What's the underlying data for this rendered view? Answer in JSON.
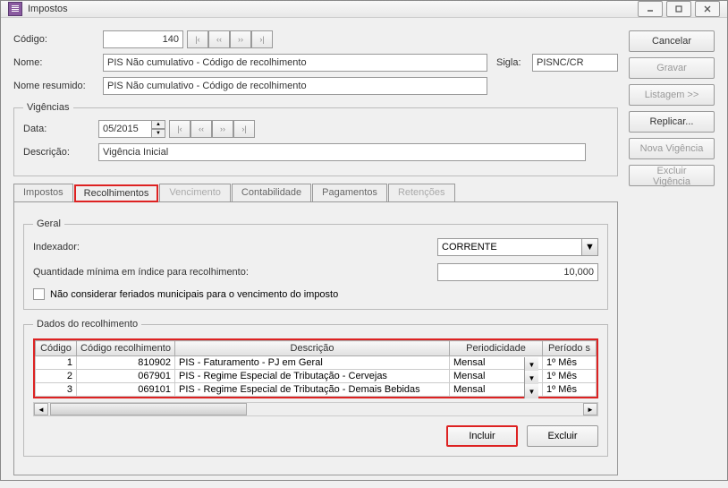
{
  "window": {
    "title": "Impostos"
  },
  "form": {
    "codigo_label": "Código:",
    "codigo_value": "140",
    "nome_label": "Nome:",
    "nome_value": "PIS Não cumulativo - Código de recolhimento",
    "sigla_label": "Sigla:",
    "sigla_value": "PISNC/CR",
    "nome_resumido_label": "Nome resumido:",
    "nome_resumido_value": "PIS Não cumulativo - Código de recolhimento"
  },
  "vigencias": {
    "legend": "Vigências",
    "data_label": "Data:",
    "data_value": "05/2015",
    "descricao_label": "Descrição:",
    "descricao_value": "Vigência Inicial"
  },
  "tabs": {
    "impostos": "Impostos",
    "recolhimentos": "Recolhimentos",
    "vencimento": "Vencimento",
    "contabilidade": "Contabilidade",
    "pagamentos": "Pagamentos",
    "retencoes": "Retenções"
  },
  "geral": {
    "legend": "Geral",
    "indexador_label": "Indexador:",
    "indexador_value": "CORRENTE",
    "quantidade_label": "Quantidade mínima em índice para recolhimento:",
    "quantidade_value": "10,000",
    "checkbox_label": "Não considerar feriados municipais para o vencimento do imposto"
  },
  "dados": {
    "legend": "Dados do recolhimento",
    "headers": {
      "codigo": "Código",
      "codigo_rec": "Código recolhimento",
      "descricao": "Descrição",
      "periodicidade": "Periodicidade",
      "periodo": "Período s"
    },
    "rows": [
      {
        "codigo": "1",
        "codigo_rec": "810902",
        "descricao": "PIS - Faturamento - PJ em Geral",
        "periodicidade": "Mensal",
        "periodo": "1º Mês"
      },
      {
        "codigo": "2",
        "codigo_rec": "067901",
        "descricao": "PIS - Regime Especial de Tributação - Cervejas",
        "periodicidade": "Mensal",
        "periodo": "1º Mês"
      },
      {
        "codigo": "3",
        "codigo_rec": "069101",
        "descricao": "PIS - Regime Especial de Tributação - Demais Bebidas",
        "periodicidade": "Mensal",
        "periodo": "1º Mês"
      }
    ]
  },
  "buttons": {
    "incluir": "Incluir",
    "excluir": "Excluir",
    "cancelar": "Cancelar",
    "gravar": "Gravar",
    "listagem": "Listagem >>",
    "replicar": "Replicar...",
    "nova_vigencia": "Nova Vigência",
    "excluir_vigencia": "Excluir Vigência"
  }
}
